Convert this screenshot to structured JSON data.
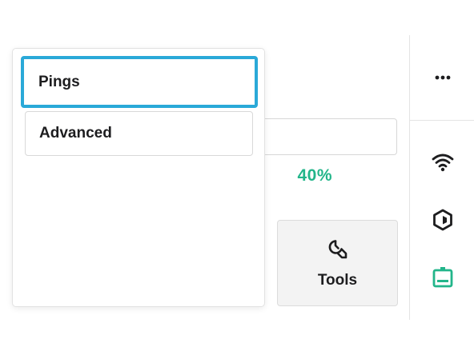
{
  "menu": {
    "items": [
      {
        "label": "Pings",
        "selected": true
      },
      {
        "label": "Advanced",
        "selected": false
      }
    ]
  },
  "status": {
    "percent_text": "40%",
    "color": "#22b58a"
  },
  "tools": {
    "label": "Tools",
    "icon": "wrench-icon"
  },
  "rail": {
    "icons": [
      "more-icon",
      "wifi-icon",
      "hexagon-icon",
      "device-icon"
    ],
    "active_color": "#22b58a"
  },
  "colors": {
    "selection_border": "#2aa9d8"
  }
}
